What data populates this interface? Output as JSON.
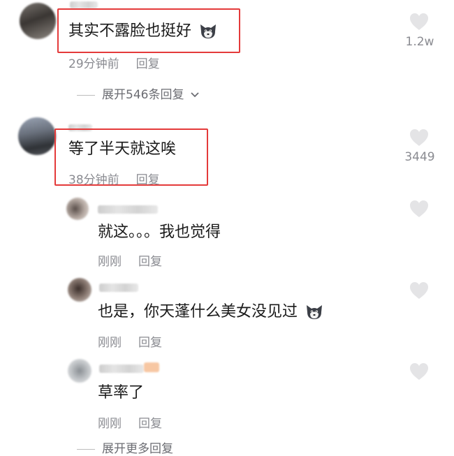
{
  "comments": [
    {
      "text": "其实不露脸也挺好",
      "time": "29分钟前",
      "reply": "回复",
      "likes": "1.2w",
      "expand": "展开546条回复",
      "emoji": "husky-emoji-icon"
    },
    {
      "text": "等了半天就这唉",
      "time": "38分钟前",
      "reply": "回复",
      "likes": "3449"
    }
  ],
  "replies": [
    {
      "text": "就这。。。我也觉得",
      "time": "刚刚",
      "reply": "回复"
    },
    {
      "text": "也是，你天蓬什么美女没见过",
      "time": "刚刚",
      "reply": "回复",
      "emoji": "husky-emoji-icon"
    },
    {
      "text": "草率了",
      "time": "刚刚",
      "reply": "回复"
    }
  ],
  "bottom_partial": "展开更多回复",
  "colors": {
    "highlight_border": "#e43a3a",
    "meta_gray": "#8a8b91",
    "heart_gray": "#e4e4e6"
  }
}
